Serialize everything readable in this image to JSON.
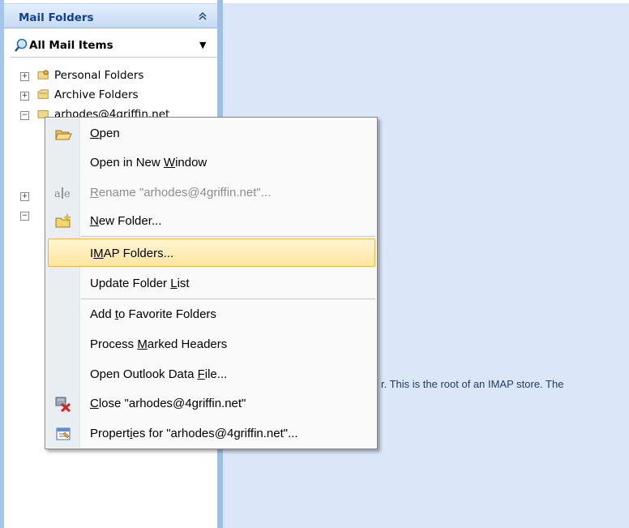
{
  "nav": {
    "title": "Mail Folders",
    "collapse_glyph": "≈",
    "all_items_label": "All Mail Items",
    "tree": [
      {
        "expander": "+",
        "label": "Personal Folders",
        "icon": "personal-folders-icon"
      },
      {
        "expander": "+",
        "label": "Archive Folders",
        "icon": "archive-folders-icon"
      },
      {
        "expander": "−",
        "label": "arhodes@4griffin.net",
        "icon": "imap-store-icon"
      }
    ]
  },
  "content": {
    "text": "r.  This is the root of an IMAP store. The"
  },
  "menu": {
    "items": [
      {
        "pre": "",
        "key": "O",
        "post": "pen",
        "icon": "open-folder-icon",
        "enabled": true
      },
      {
        "pre": "Open in New ",
        "key": "W",
        "post": "indow",
        "icon": "",
        "enabled": true
      },
      {
        "pre": "",
        "key": "R",
        "post": "ename \"arhodes@4griffin.net\"...",
        "icon": "rename-icon",
        "enabled": false
      },
      {
        "pre": "",
        "key": "N",
        "post": "ew Folder...",
        "icon": "new-folder-icon",
        "enabled": true
      },
      {
        "pre": "I",
        "key": "M",
        "post": "AP Folders...",
        "icon": "",
        "enabled": true,
        "highlighted": true
      },
      {
        "pre": "Update Folder ",
        "key": "L",
        "post": "ist",
        "icon": "",
        "enabled": true
      },
      {
        "pre": "Add ",
        "key": "t",
        "post": "o Favorite Folders",
        "icon": "",
        "enabled": true
      },
      {
        "pre": "Process ",
        "key": "M",
        "post": "arked Headers",
        "icon": "",
        "enabled": true
      },
      {
        "pre": "Open Outlook Data ",
        "key": "F",
        "post": "ile...",
        "icon": "",
        "enabled": true
      },
      {
        "pre": "",
        "key": "C",
        "post": "lose \"arhodes@4griffin.net\"",
        "icon": "close-store-icon",
        "enabled": true
      },
      {
        "pre": "Propert",
        "key": "i",
        "post": "es for \"arhodes@4griffin.net\"...",
        "icon": "properties-icon",
        "enabled": true
      }
    ]
  }
}
